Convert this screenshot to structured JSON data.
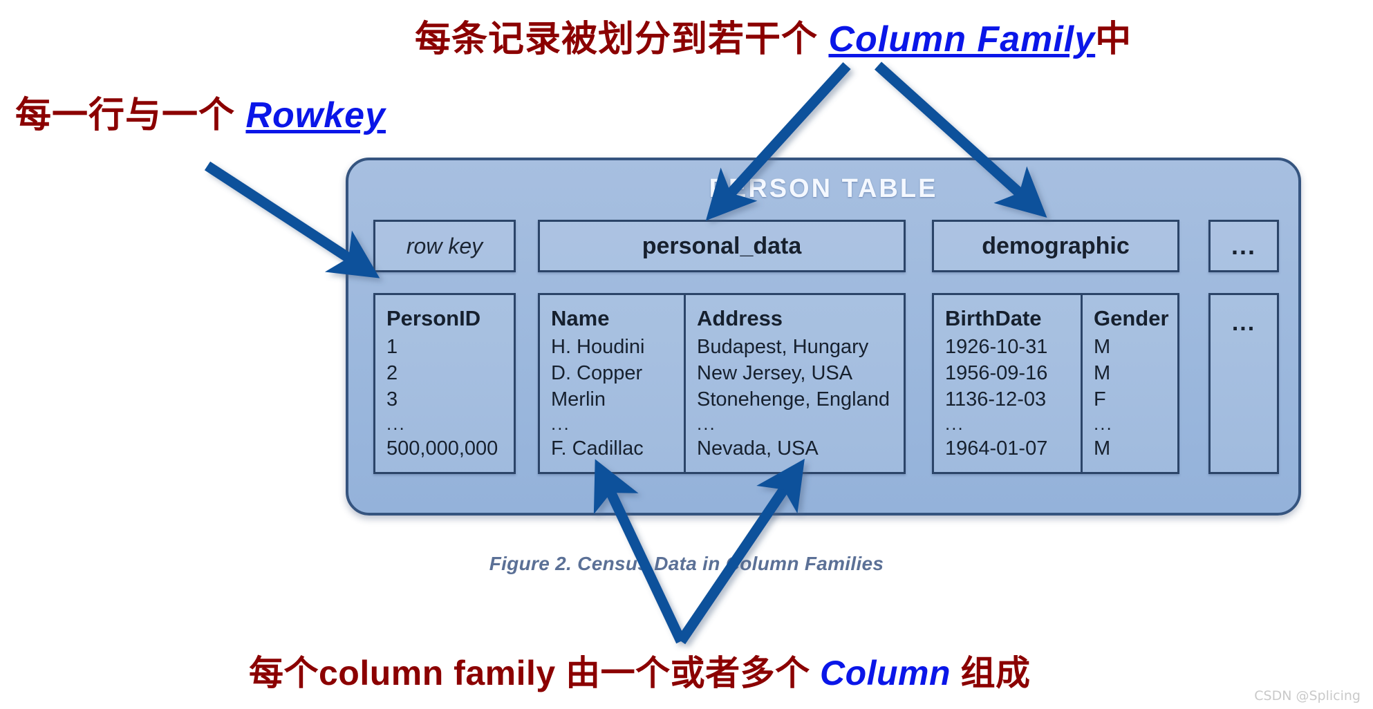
{
  "annotations": {
    "top": {
      "prefix": "每条记录被划分到若干个 ",
      "highlight": "Column Family",
      "suffix": "中"
    },
    "left": {
      "prefix": "每一行与一个 ",
      "highlight": "Rowkey",
      "suffix": ""
    },
    "bottom": {
      "prefix": "每个column family 由一个或者多个 ",
      "highlight": "Column",
      "suffix": " 组成"
    }
  },
  "diagram": {
    "title": "PERSON  TABLE",
    "caption": "Figure 2. Census Data in Column Families",
    "column_family_headers": [
      "row key",
      "personal_data",
      "demographic",
      "..."
    ],
    "groups": [
      {
        "family": "row key",
        "columns": [
          {
            "header": "PersonID",
            "values": [
              "1",
              "2",
              "3",
              "...",
              "500,000,000"
            ]
          }
        ]
      },
      {
        "family": "personal_data",
        "columns": [
          {
            "header": "Name",
            "values": [
              "H. Houdini",
              "D. Copper",
              "Merlin",
              "...",
              "F. Cadillac"
            ]
          },
          {
            "header": "Address",
            "values": [
              "Budapest, Hungary",
              "New Jersey, USA",
              "Stonehenge, England",
              "...",
              "Nevada, USA"
            ]
          }
        ]
      },
      {
        "family": "demographic",
        "columns": [
          {
            "header": "BirthDate",
            "values": [
              "1926-10-31",
              "1956-09-16",
              "1136-12-03",
              "...",
              "1964-01-07"
            ]
          },
          {
            "header": "Gender",
            "values": [
              "M",
              "M",
              "F",
              "...",
              "M"
            ]
          }
        ]
      },
      {
        "family": "...",
        "columns": [
          {
            "header": "...",
            "values": []
          }
        ]
      }
    ]
  },
  "watermark": "CSDN @Splicing",
  "colors": {
    "annotation_text": "#8B0000",
    "highlight_text": "#0A16E8",
    "arrow": "#10519B",
    "panel_fill": "#9EB9DD",
    "panel_border": "#35547F",
    "box_border": "#2B4468",
    "caption": "#5B7096",
    "watermark": "#C9C9C9"
  }
}
